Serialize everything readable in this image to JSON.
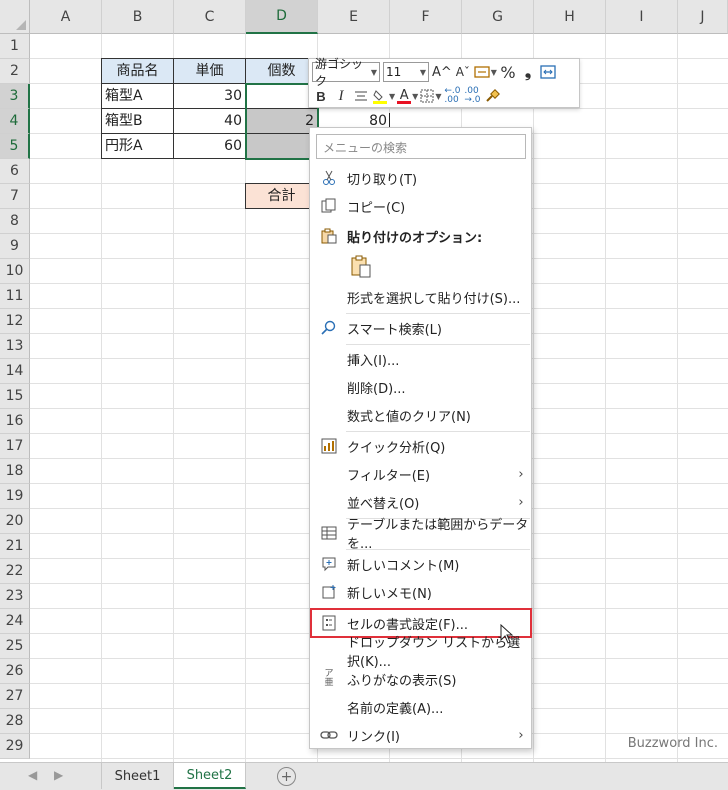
{
  "columns": [
    "A",
    "B",
    "C",
    "D",
    "E",
    "F",
    "G",
    "H",
    "I",
    "J"
  ],
  "rows": [
    "1",
    "2",
    "3",
    "4",
    "5",
    "6",
    "7",
    "8",
    "9",
    "10",
    "11",
    "12",
    "13",
    "14",
    "15",
    "16",
    "17",
    "18",
    "19",
    "20",
    "21",
    "22",
    "23",
    "24",
    "25",
    "26",
    "27",
    "28",
    "29"
  ],
  "table": {
    "headers": [
      "商品名",
      "単価",
      "個数"
    ],
    "rows": [
      {
        "name": "箱型A",
        "price": "30",
        "qty": ""
      },
      {
        "name": "箱型B",
        "price": "40",
        "qty": "2"
      },
      {
        "name": "円形A",
        "price": "60",
        "qty": ""
      }
    ],
    "e4_value": "80",
    "total_label": "合計"
  },
  "mini_toolbar": {
    "font_name": "游ゴシック",
    "font_size": "11",
    "grow_font": "A^",
    "shrink_font": "Aˇ",
    "percent": "%",
    "comma": "❟",
    "bold": "B",
    "italic": "I",
    "font_color_letter": "A",
    "font_color": "#e81123",
    "fill_color": "#ffff00"
  },
  "context_menu": {
    "search_placeholder": "メニューの検索",
    "items": [
      {
        "label": "切り取り(T)",
        "icon": "scissors-icon"
      },
      {
        "label": "コピー(C)",
        "icon": "copy-icon"
      },
      {
        "label": "貼り付けのオプション:",
        "icon": "clipboard-icon"
      },
      {
        "label": "形式を選択して貼り付け(S)...",
        "icon": ""
      },
      {
        "label": "スマート検索(L)",
        "icon": "smart-lookup-icon"
      },
      {
        "label": "挿入(I)...",
        "icon": ""
      },
      {
        "label": "削除(D)...",
        "icon": ""
      },
      {
        "label": "数式と値のクリア(N)",
        "icon": ""
      },
      {
        "label": "クイック分析(Q)",
        "icon": "quick-analysis-icon"
      },
      {
        "label": "フィルター(E)",
        "icon": ""
      },
      {
        "label": "並べ替え(O)",
        "icon": ""
      },
      {
        "label": "テーブルまたは範囲からデータを...",
        "icon": "table-icon"
      },
      {
        "label": "新しいコメント(M)",
        "icon": "comment-icon"
      },
      {
        "label": "新しいメモ(N)",
        "icon": "note-icon"
      },
      {
        "label": "セルの書式設定(F)...",
        "icon": "format-cells-icon"
      },
      {
        "label": "ドロップダウン リストから選択(K)...",
        "icon": ""
      },
      {
        "label": "ふりがなの表示(S)",
        "icon": "furigana-icon"
      },
      {
        "label": "名前の定義(A)...",
        "icon": ""
      },
      {
        "label": "リンク(I)",
        "icon": "link-icon"
      }
    ]
  },
  "sheets": [
    "Sheet1",
    "Sheet2"
  ],
  "active_sheet": "Sheet2",
  "watermark": "Buzzword Inc."
}
